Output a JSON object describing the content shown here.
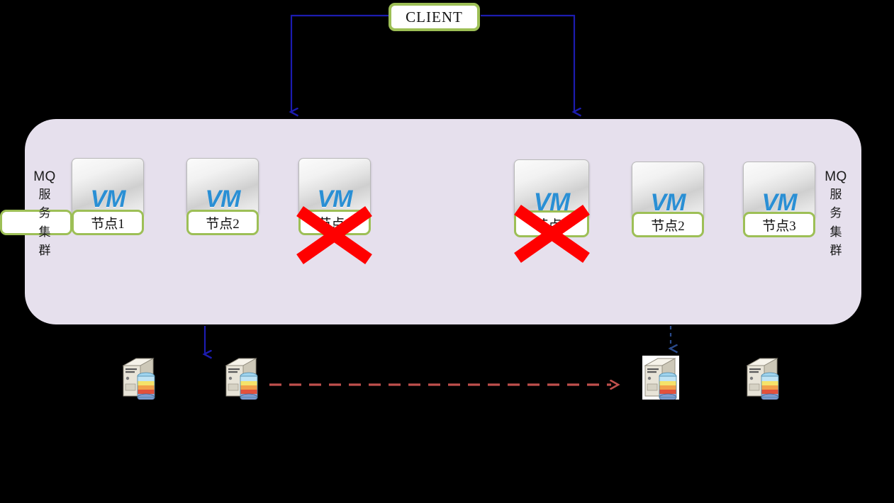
{
  "diagram": {
    "title_box": {
      "label": "CLIENT"
    },
    "cluster_left": {
      "side_label_top": "MQ",
      "side_label_vertical": [
        "服",
        "务",
        "集",
        "群"
      ],
      "nodes": [
        {
          "label": "节点1",
          "vm_text": "VM",
          "failed": false
        },
        {
          "label": "节点2",
          "vm_text": "VM",
          "failed": false
        },
        {
          "label": "节点3",
          "vm_text": "VM",
          "failed": true
        }
      ]
    },
    "cluster_right": {
      "side_label_top": "MQ",
      "side_label_vertical": [
        "服",
        "务",
        "集",
        "群"
      ],
      "nodes": [
        {
          "label": "节点1",
          "vm_text": "VM",
          "failed": true
        },
        {
          "label": "节点2",
          "vm_text": "VM",
          "failed": false
        },
        {
          "label": "节点3",
          "vm_text": "VM",
          "failed": false
        }
      ]
    },
    "storage_nodes": [
      {
        "name": "db-server-1"
      },
      {
        "name": "db-server-2"
      },
      {
        "name": "db-server-3"
      },
      {
        "name": "db-server-4"
      }
    ],
    "connections": [
      {
        "from": "client",
        "to": "cluster-left",
        "style": "solid",
        "color": "#1c1cb0"
      },
      {
        "from": "client",
        "to": "cluster-right",
        "style": "solid",
        "color": "#1c1cb0"
      },
      {
        "from": "cluster-left",
        "to": "db-server-2",
        "style": "solid",
        "color": "#1c1cb0"
      },
      {
        "from": "cluster-right",
        "to": "db-server-3",
        "style": "dotted",
        "color": "#2a4a8a"
      },
      {
        "from": "db-server-2",
        "to": "db-server-3",
        "style": "dashed",
        "color": "#c0504d"
      }
    ],
    "colors": {
      "panel": "#e6e0ed",
      "accent_green": "#9dbf56",
      "vm_blue": "#2a8fd4",
      "arrow_blue": "#1c1cb0",
      "replication_red": "#c0504d",
      "failure_x": "#ff0000",
      "background": "#000000"
    }
  }
}
